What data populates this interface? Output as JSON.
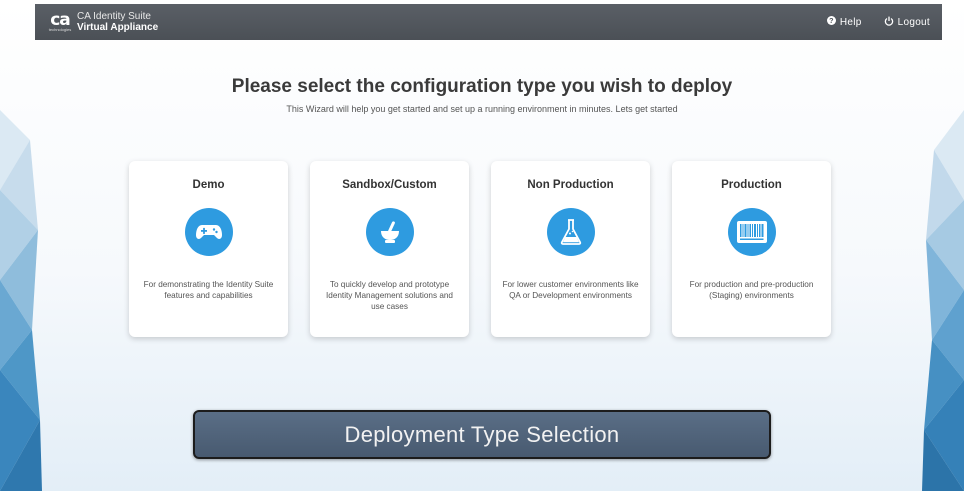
{
  "topbar": {
    "logo_mark": "ca",
    "logo_tagline": "technologies",
    "title_line1": "CA Identity Suite",
    "title_line2": "Virtual Appliance",
    "help_label": "Help",
    "logout_label": "Logout"
  },
  "main": {
    "heading": "Please select the configuration type you wish to deploy",
    "subheading": "This Wizard will help you get started and set up a running environment in minutes. Lets get started"
  },
  "cards": [
    {
      "title": "Demo",
      "icon": "gamepad-icon",
      "desc": "For demonstrating the Identity Suite features and capabilities"
    },
    {
      "title": "Sandbox/Custom",
      "icon": "mortar-pestle-icon",
      "desc": "To quickly develop and prototype Identity Management solutions and use cases"
    },
    {
      "title": "Non Production",
      "icon": "flask-icon",
      "desc": "For lower customer environments like QA or Development environments"
    },
    {
      "title": "Production",
      "icon": "barcode-icon",
      "desc": "For production and pre-production (Staging) environments"
    }
  ],
  "caption": "Deployment Type Selection",
  "colors": {
    "topbar": "#4e5359",
    "icon_circle": "#2e9be0",
    "caption_bg": "#526780"
  }
}
